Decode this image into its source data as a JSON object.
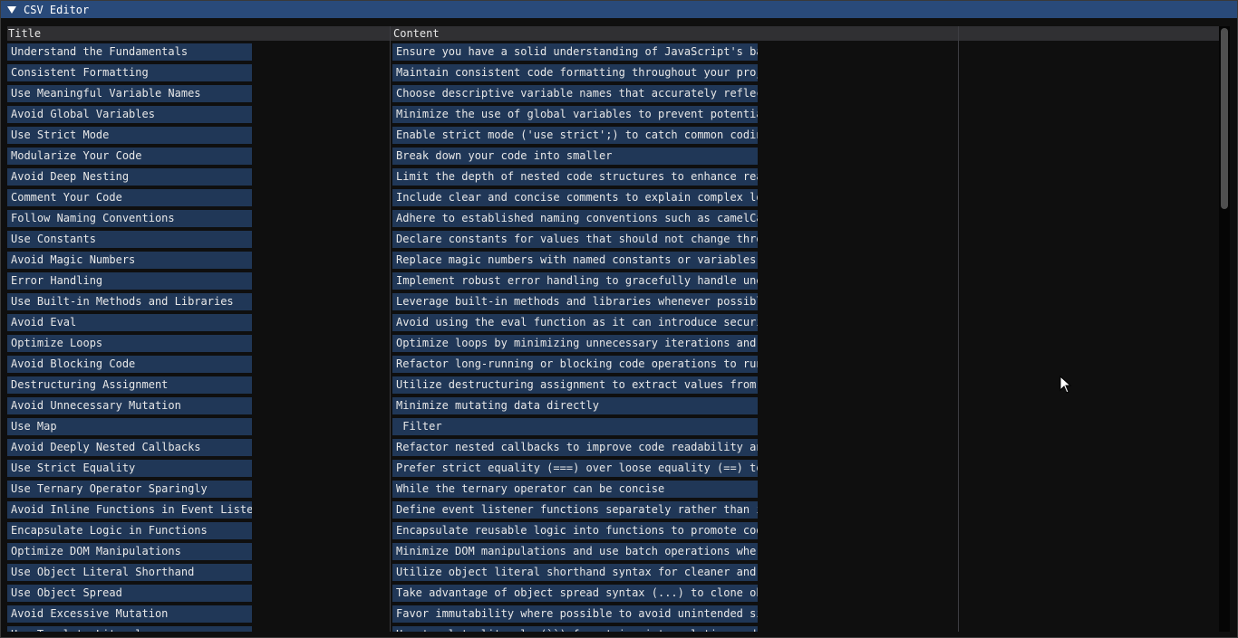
{
  "window": {
    "title": "CSV Editor",
    "collapse_icon": "triangle-down-icon"
  },
  "table": {
    "columns": [
      "Title",
      "Content",
      "",
      ""
    ],
    "rows": [
      {
        "title": "Understand the Fundamentals",
        "content": "Ensure you have a solid understanding of JavaScript's bas"
      },
      {
        "title": "Consistent Formatting",
        "content": "Maintain consistent code formatting throughout your proje"
      },
      {
        "title": "Use Meaningful Variable Names",
        "content": "Choose descriptive variable names that accurately reflect"
      },
      {
        "title": "Avoid Global Variables",
        "content": "Minimize the use of global variables to prevent potential"
      },
      {
        "title": "Use Strict Mode",
        "content": "Enable strict mode ('use strict';) to catch common coding"
      },
      {
        "title": "Modularize Your Code",
        "content": "Break down your code into smaller"
      },
      {
        "title": "Avoid Deep Nesting",
        "content": "Limit the depth of nested code structures to enhance read"
      },
      {
        "title": "Comment Your Code",
        "content": "Include clear and concise comments to explain complex log"
      },
      {
        "title": "Follow Naming Conventions",
        "content": "Adhere to established naming conventions such as camelCas"
      },
      {
        "title": "Use Constants",
        "content": "Declare constants for values that should not change throu"
      },
      {
        "title": "Avoid Magic Numbers",
        "content": "Replace magic numbers with named constants or variables t"
      },
      {
        "title": "Error Handling",
        "content": "Implement robust error handling to gracefully handle unex"
      },
      {
        "title": "Use Built-in Methods and Libraries",
        "content": "Leverage built-in methods and libraries whenever possible"
      },
      {
        "title": "Avoid Eval",
        "content": "Avoid using the eval function as it can introduce securit"
      },
      {
        "title": "Optimize Loops",
        "content": "Optimize loops by minimizing unnecessary iterations and u"
      },
      {
        "title": "Avoid Blocking Code",
        "content": "Refactor long-running or blocking code operations to run "
      },
      {
        "title": "Destructuring Assignment",
        "content": "Utilize destructuring assignment to extract values from a"
      },
      {
        "title": "Avoid Unnecessary Mutation",
        "content": "Minimize mutating data directly"
      },
      {
        "title": "Use Map",
        "content": " Filter"
      },
      {
        "title": "Avoid Deeply Nested Callbacks",
        "content": "Refactor nested callbacks to improve code readability and"
      },
      {
        "title": "Use Strict Equality",
        "content": "Prefer strict equality (===) over loose equality (==) to "
      },
      {
        "title": "Use Ternary Operator Sparingly",
        "content": "While the ternary operator can be concise"
      },
      {
        "title": "Avoid Inline Functions in Event Listen",
        "content": "Define event listener functions separately rather than in"
      },
      {
        "title": "Encapsulate Logic in Functions",
        "content": "Encapsulate reusable logic into functions to promote code"
      },
      {
        "title": "Optimize DOM Manipulations",
        "content": "Minimize DOM manipulations and use batch operations where"
      },
      {
        "title": "Use Object Literal Shorthand",
        "content": "Utilize object literal shorthand syntax for cleaner and m"
      },
      {
        "title": "Use Object Spread",
        "content": "Take advantage of object spread syntax (...) to clone obj"
      },
      {
        "title": "Avoid Excessive Mutation",
        "content": "Favor immutability where possible to avoid unintended sid"
      },
      {
        "title": "Use Template Literals",
        "content": "Use template literals (``) for string interpolation and m"
      }
    ]
  },
  "colors": {
    "titlebar": "#294a7a",
    "cell_background": "#203757",
    "header_background": "#303033",
    "window_background": "#0f0f0f"
  },
  "scrollbar": {
    "visible_fraction": 0.3
  }
}
